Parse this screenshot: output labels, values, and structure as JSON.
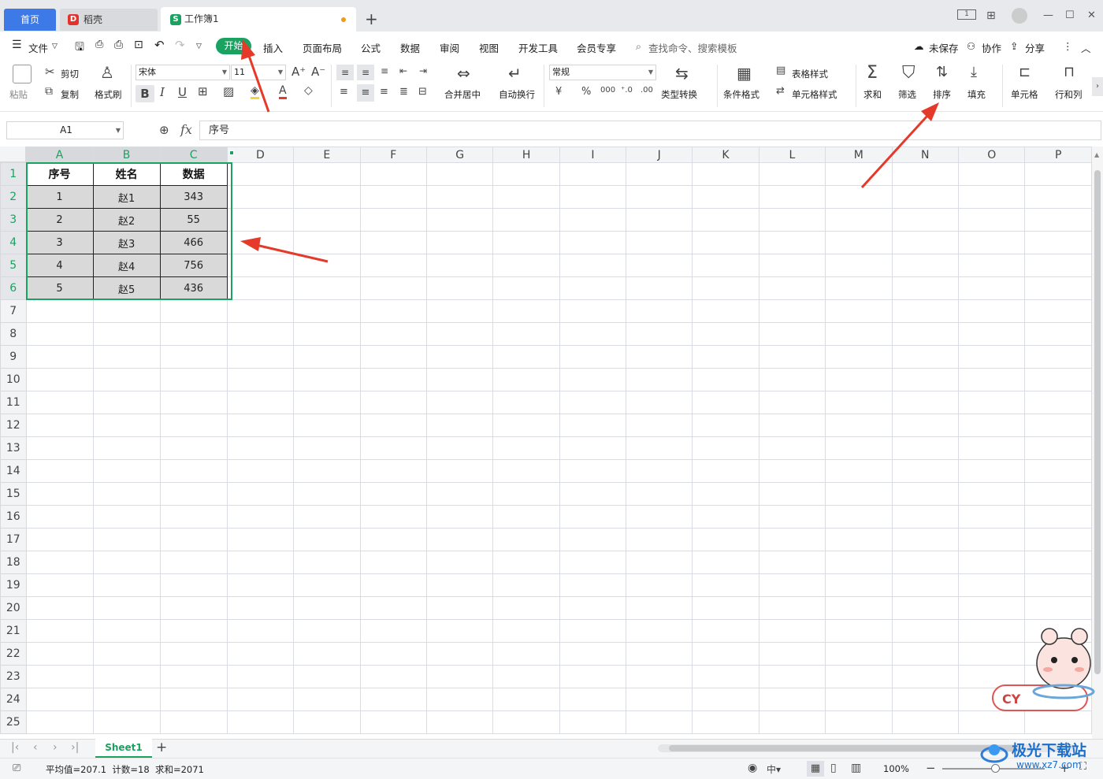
{
  "tabs": {
    "home": "首页",
    "doc": "稻壳",
    "active": "工作簿1"
  },
  "menu": {
    "file": "文件",
    "items": [
      "开始",
      "插入",
      "页面布局",
      "公式",
      "数据",
      "审阅",
      "视图",
      "开发工具",
      "会员专享"
    ],
    "search": "查找命令、搜索模板",
    "unsaved": "未保存",
    "collab": "协作",
    "share": "分享"
  },
  "ribbon": {
    "paste": "粘贴",
    "cut": "剪切",
    "copy": "复制",
    "format_painter": "格式刷",
    "font_name": "宋体",
    "font_size": "11",
    "merge_center": "合并居中",
    "wrap_text": "自动换行",
    "number_format": "常规",
    "type_convert": "类型转换",
    "conditional_format": "条件格式",
    "table_style": "表格样式",
    "cell_style": "单元格样式",
    "sum": "求和",
    "filter": "筛选",
    "sort": "排序",
    "fill": "填充",
    "cell": "单元格",
    "row_col": "行和列"
  },
  "formula_bar": {
    "cell_ref": "A1",
    "fx": "fx",
    "content": "序号"
  },
  "sheet": {
    "columns": [
      "A",
      "B",
      "C",
      "D",
      "E",
      "F",
      "G",
      "H",
      "I",
      "J",
      "K",
      "L",
      "M",
      "N",
      "O",
      "P"
    ],
    "row_count": 25,
    "header": [
      "序号",
      "姓名",
      "数据"
    ],
    "rows": [
      [
        "1",
        "赵1",
        "343"
      ],
      [
        "2",
        "赵2",
        "55"
      ],
      [
        "3",
        "赵3",
        "466"
      ],
      [
        "4",
        "赵4",
        "756"
      ],
      [
        "5",
        "赵5",
        "436"
      ]
    ]
  },
  "sheet_tabs": {
    "active": "Sheet1"
  },
  "status": {
    "stats": "平均值=207.1  计数=18  求和=2071",
    "zoom": "100%"
  },
  "watermark": "极光下载站",
  "watermark_url": "www.xz7.com"
}
